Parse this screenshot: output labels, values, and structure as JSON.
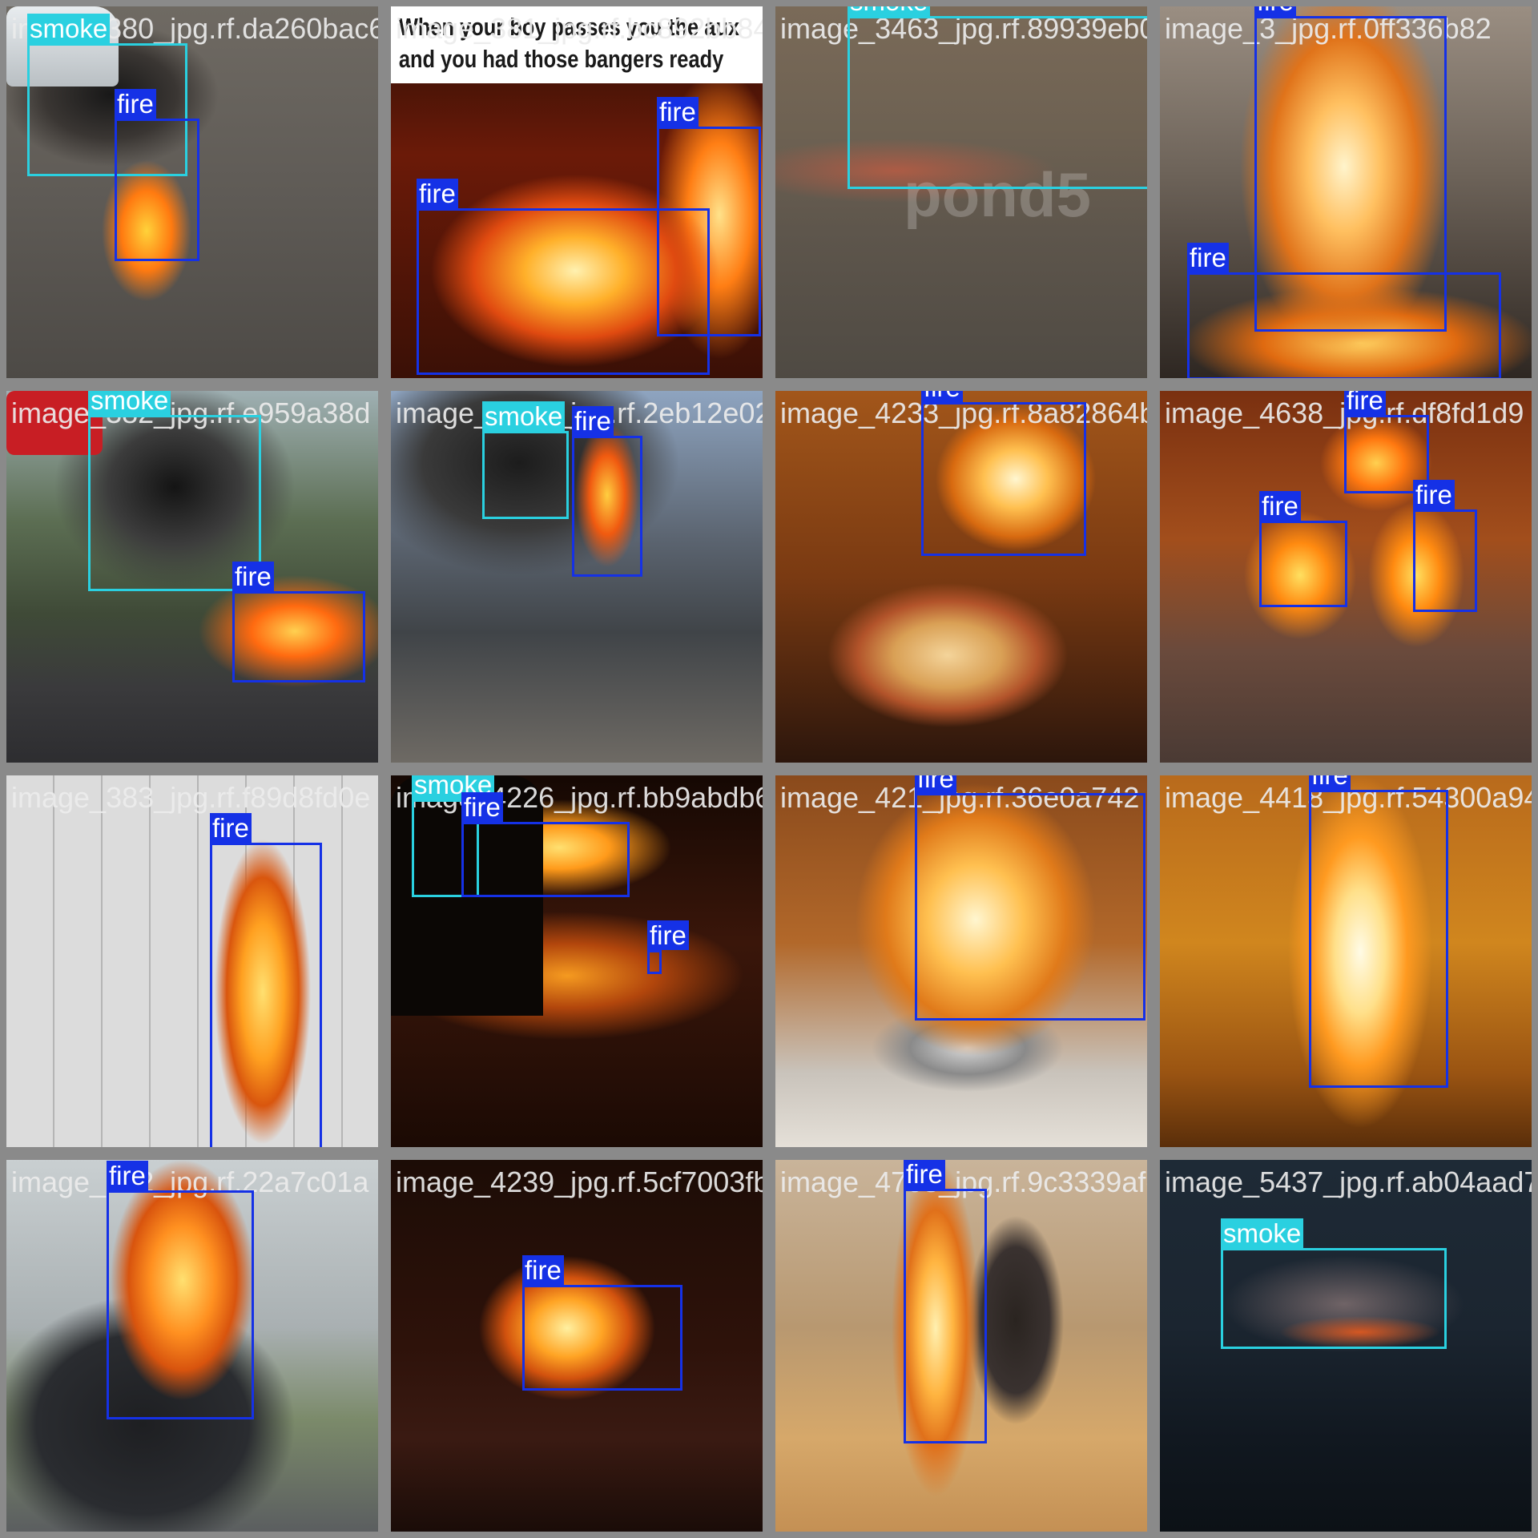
{
  "colors": {
    "fire": "#1531e6",
    "smoke": "#2ad0e0"
  },
  "tiles": [
    {
      "filename": "image_380_jpg.rf.da260bac6",
      "boxes": [
        {
          "label": "smoke"
        },
        {
          "label": "fire"
        }
      ]
    },
    {
      "filename": "image_381_jpg.rf.bc892bb840",
      "caption": "When your boy passes you the aux and you had those bangers ready",
      "boxes": [
        {
          "label": "fire"
        },
        {
          "label": "fire"
        }
      ]
    },
    {
      "filename": "image_3463_jpg.rf.89939eb05",
      "watermark": "pond5",
      "boxes": [
        {
          "label": "smoke"
        }
      ]
    },
    {
      "filename": "image_3_jpg.rf.0ff336b82",
      "boxes": [
        {
          "label": "fire"
        },
        {
          "label": "fire"
        }
      ]
    },
    {
      "filename": "image_382_jpg.rf.e959a38d",
      "boxes": [
        {
          "label": "smoke"
        },
        {
          "label": "fire"
        }
      ]
    },
    {
      "filename": "image_1903_jpg.rf.2eb12e02",
      "boxes": [
        {
          "label": "smoke"
        },
        {
          "label": "fire"
        }
      ]
    },
    {
      "filename": "image_4233_jpg.rf.8a82864b",
      "boxes": [
        {
          "label": "fire"
        }
      ]
    },
    {
      "filename": "image_4638_jpg.rf.df8fd1d9",
      "boxes": [
        {
          "label": "fire"
        },
        {
          "label": "fire"
        },
        {
          "label": "fire"
        }
      ]
    },
    {
      "filename": "image_383_jpg.rf.f89d8fd0e",
      "boxes": [
        {
          "label": "fire"
        }
      ]
    },
    {
      "filename": "image_4226_jpg.rf.bb9abdb6",
      "boxes": [
        {
          "label": "smoke"
        },
        {
          "label": "fire"
        },
        {
          "label": "fire"
        }
      ]
    },
    {
      "filename": "image_421_jpg.rf.36e0a742",
      "boxes": [
        {
          "label": "fire"
        }
      ]
    },
    {
      "filename": "image_4418_jpg.rf.54300a94",
      "boxes": [
        {
          "label": "fire"
        }
      ]
    },
    {
      "filename": "image_392_jpg.rf.22a7c01a",
      "boxes": [
        {
          "label": "fire"
        }
      ]
    },
    {
      "filename": "image_4239_jpg.rf.5cf7003fb",
      "boxes": [
        {
          "label": "fire"
        }
      ]
    },
    {
      "filename": "image_4708_jpg.rf.9c3339afe",
      "boxes": [
        {
          "label": "fire"
        }
      ]
    },
    {
      "filename": "image_5437_jpg.rf.ab04aad7",
      "boxes": [
        {
          "label": "smoke"
        }
      ]
    }
  ]
}
